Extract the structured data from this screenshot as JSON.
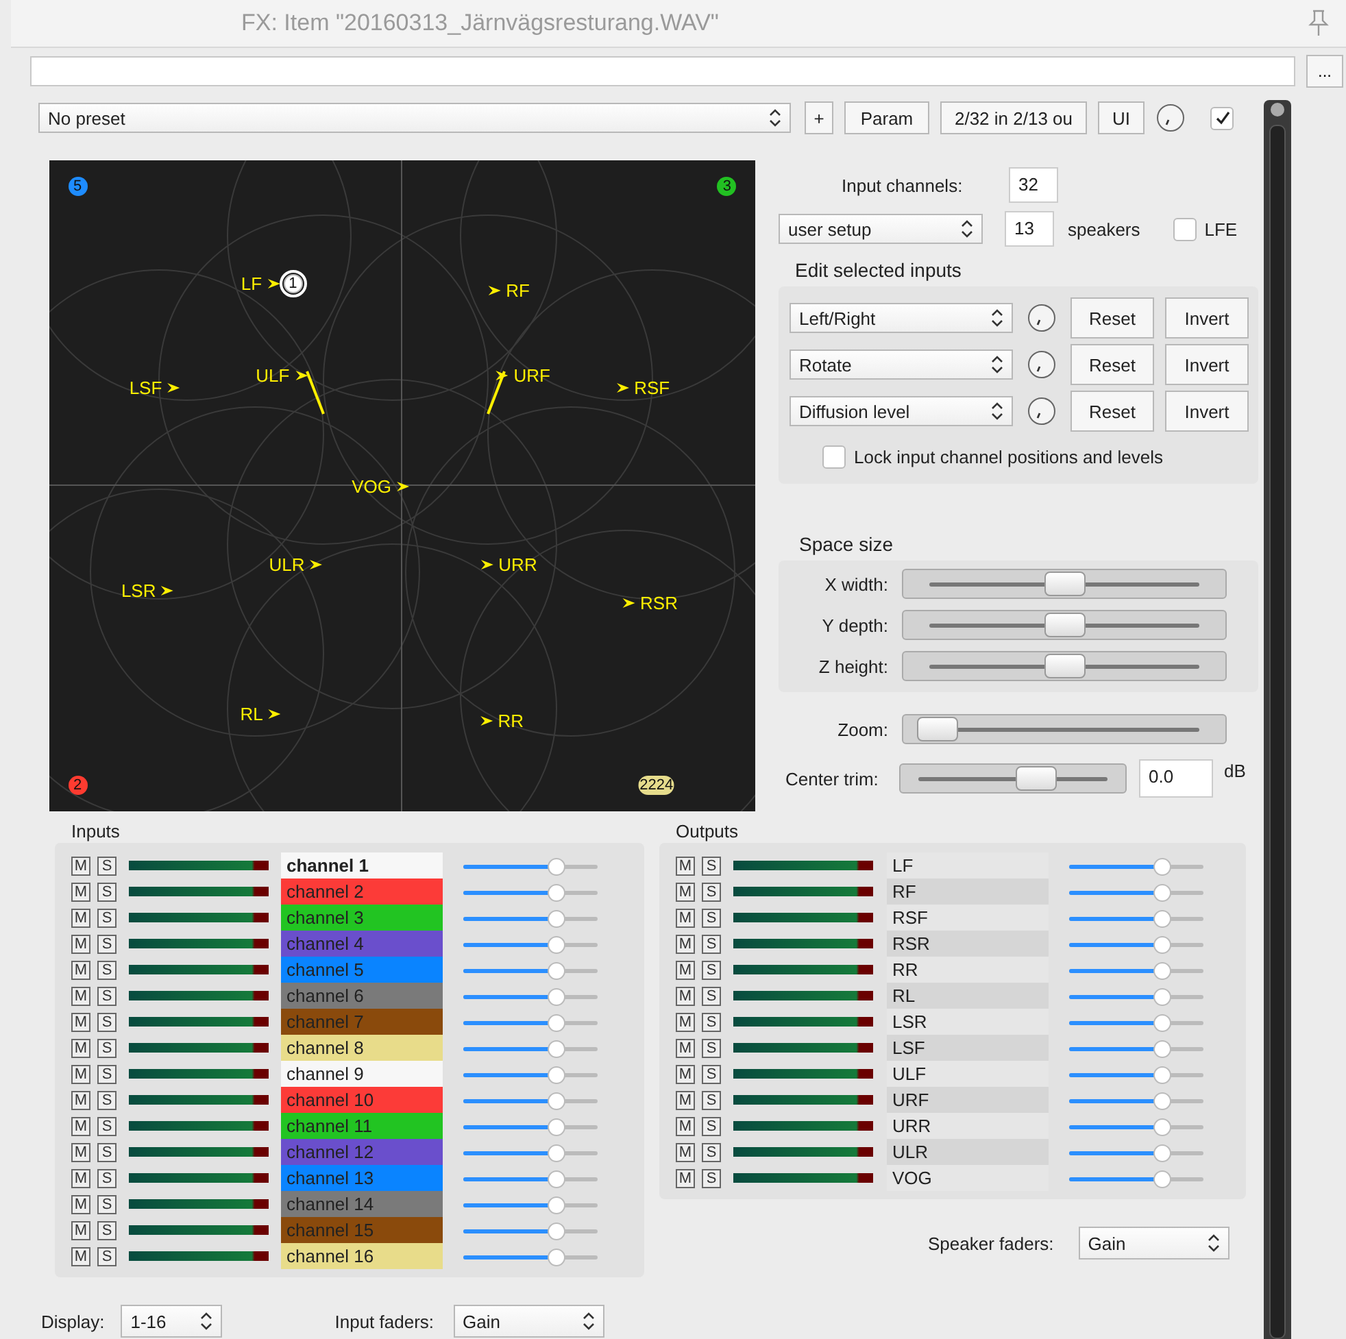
{
  "window": {
    "title": "FX: Item \"20160313_Järnvägsresturang.WAV\""
  },
  "more_button": "...",
  "preset_bar": {
    "preset": "No preset",
    "add": "+",
    "param": "Param",
    "io": "2/32 in 2/13 ou",
    "ui": "UI",
    "enabled": true
  },
  "plot": {
    "speakers": [
      {
        "label": "LF"
      },
      {
        "label": "RF"
      },
      {
        "label": "LSF"
      },
      {
        "label": "ULF"
      },
      {
        "label": "URF"
      },
      {
        "label": "RSF"
      },
      {
        "label": "VOG"
      },
      {
        "label": "ULR"
      },
      {
        "label": "URR"
      },
      {
        "label": "LSR"
      },
      {
        "label": "RSR"
      },
      {
        "label": "RL"
      },
      {
        "label": "RR"
      }
    ],
    "inputs": [
      {
        "label": "5",
        "color": "#1e8cff",
        "selected": false
      },
      {
        "label": "3",
        "color": "#22c022",
        "selected": false
      },
      {
        "label": "1",
        "color": "#ffffff",
        "selected": true
      },
      {
        "label": "2",
        "color": "#ff3b30",
        "selected": false
      },
      {
        "label": "2224",
        "color": "#e6dc8c",
        "selected": false
      }
    ]
  },
  "setup": {
    "input_channels_label": "Input channels:",
    "input_channels": "32",
    "layout": "user setup",
    "speakers": "13",
    "speakers_label": "speakers",
    "lfe_label": "LFE",
    "lfe": false
  },
  "edit_inputs": {
    "title": "Edit selected inputs",
    "rows": [
      {
        "param": "Left/Right",
        "reset": "Reset",
        "invert": "Invert"
      },
      {
        "param": "Rotate",
        "reset": "Reset",
        "invert": "Invert"
      },
      {
        "param": "Diffusion level",
        "reset": "Reset",
        "invert": "Invert"
      }
    ],
    "lock_label": "Lock input channel positions and levels",
    "lock": false
  },
  "space_size": {
    "title": "Space size",
    "sliders": [
      {
        "label": "X width:",
        "level": 0.5
      },
      {
        "label": "Y depth:",
        "level": 0.5
      },
      {
        "label": "Z height:",
        "level": 0.5
      }
    ]
  },
  "zoom": {
    "label": "Zoom:",
    "level": 0.03
  },
  "center_trim": {
    "label": "Center trim:",
    "level": 0.62,
    "value": "0.0",
    "unit": "dB"
  },
  "inputs": {
    "title": "Inputs",
    "channels": [
      {
        "mute": "M",
        "solo": "S",
        "name": "channel 1",
        "color": "#f7f7f7",
        "level": 0.69,
        "selected": true
      },
      {
        "mute": "M",
        "solo": "S",
        "name": "channel 2",
        "color": "#fc3b38",
        "level": 0.69,
        "selected": false
      },
      {
        "mute": "M",
        "solo": "S",
        "name": "channel 3",
        "color": "#22c422",
        "level": 0.69,
        "selected": false
      },
      {
        "mute": "M",
        "solo": "S",
        "name": "channel 4",
        "color": "#6a4fcc",
        "level": 0.69,
        "selected": false
      },
      {
        "mute": "M",
        "solo": "S",
        "name": "channel 5",
        "color": "#0a84ff",
        "level": 0.69,
        "selected": false
      },
      {
        "mute": "M",
        "solo": "S",
        "name": "channel 6",
        "color": "#7a7a7a",
        "level": 0.69,
        "selected": false
      },
      {
        "mute": "M",
        "solo": "S",
        "name": "channel 7",
        "color": "#8a4a0c",
        "level": 0.69,
        "selected": false
      },
      {
        "mute": "M",
        "solo": "S",
        "name": "channel 8",
        "color": "#e8dc8a",
        "level": 0.69,
        "selected": false
      },
      {
        "mute": "M",
        "solo": "S",
        "name": "channel 9",
        "color": "#f7f7f7",
        "level": 0.69,
        "selected": false
      },
      {
        "mute": "M",
        "solo": "S",
        "name": "channel 10",
        "color": "#fc3b38",
        "level": 0.69,
        "selected": false
      },
      {
        "mute": "M",
        "solo": "S",
        "name": "channel 11",
        "color": "#22c422",
        "level": 0.69,
        "selected": false
      },
      {
        "mute": "M",
        "solo": "S",
        "name": "channel 12",
        "color": "#6a4fcc",
        "level": 0.69,
        "selected": false
      },
      {
        "mute": "M",
        "solo": "S",
        "name": "channel 13",
        "color": "#0a84ff",
        "level": 0.69,
        "selected": false
      },
      {
        "mute": "M",
        "solo": "S",
        "name": "channel 14",
        "color": "#7a7a7a",
        "level": 0.69,
        "selected": false
      },
      {
        "mute": "M",
        "solo": "S",
        "name": "channel 15",
        "color": "#8a4a0c",
        "level": 0.69,
        "selected": false
      },
      {
        "mute": "M",
        "solo": "S",
        "name": "channel 16",
        "color": "#e8dc8a",
        "level": 0.69,
        "selected": false
      }
    ]
  },
  "outputs": {
    "title": "Outputs",
    "channels": [
      {
        "mute": "M",
        "solo": "S",
        "name": "LF",
        "level": 0.69
      },
      {
        "mute": "M",
        "solo": "S",
        "name": "RF",
        "level": 0.69
      },
      {
        "mute": "M",
        "solo": "S",
        "name": "RSF",
        "level": 0.69
      },
      {
        "mute": "M",
        "solo": "S",
        "name": "RSR",
        "level": 0.69
      },
      {
        "mute": "M",
        "solo": "S",
        "name": "RR",
        "level": 0.69
      },
      {
        "mute": "M",
        "solo": "S",
        "name": "RL",
        "level": 0.69
      },
      {
        "mute": "M",
        "solo": "S",
        "name": "LSR",
        "level": 0.69
      },
      {
        "mute": "M",
        "solo": "S",
        "name": "LSF",
        "level": 0.69
      },
      {
        "mute": "M",
        "solo": "S",
        "name": "ULF",
        "level": 0.69
      },
      {
        "mute": "M",
        "solo": "S",
        "name": "URF",
        "level": 0.69
      },
      {
        "mute": "M",
        "solo": "S",
        "name": "URR",
        "level": 0.69
      },
      {
        "mute": "M",
        "solo": "S",
        "name": "ULR",
        "level": 0.69
      },
      {
        "mute": "M",
        "solo": "S",
        "name": "VOG",
        "level": 0.69
      }
    ]
  },
  "speaker_faders": {
    "label": "Speaker faders:",
    "value": "Gain"
  },
  "display": {
    "label": "Display:",
    "value": "1-16"
  },
  "input_faders": {
    "label": "Input faders:",
    "value": "Gain"
  }
}
